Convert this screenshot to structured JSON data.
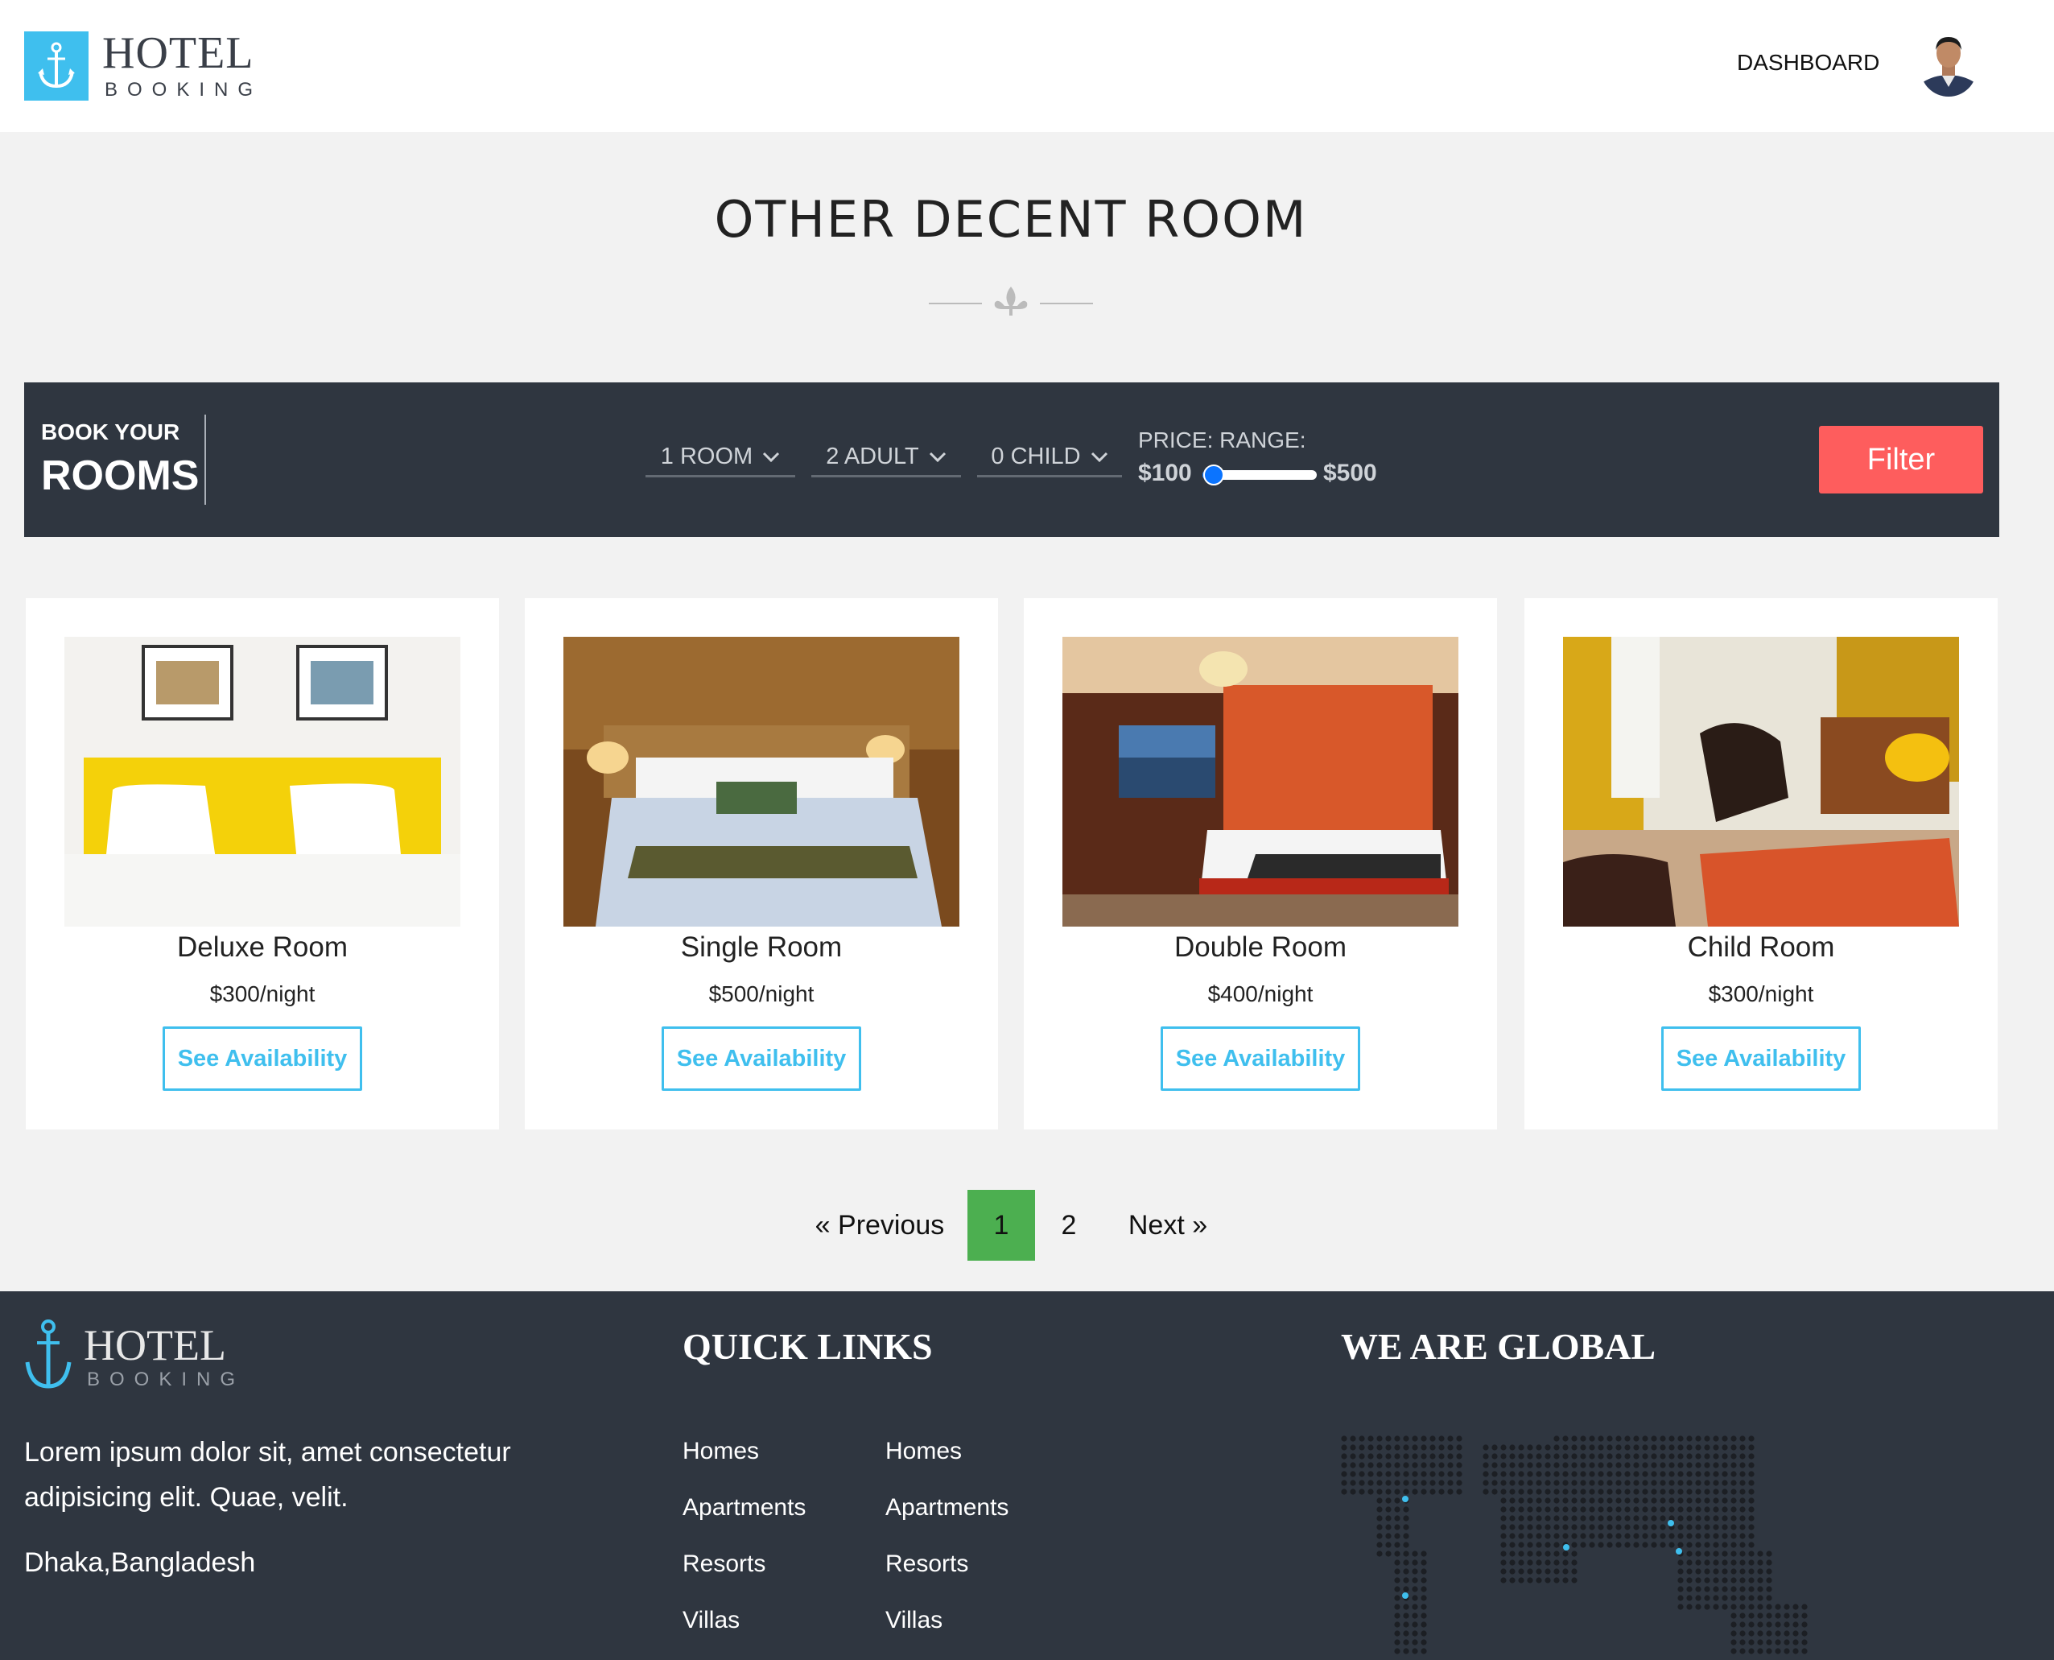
{
  "header": {
    "logo_title": "HOTEL",
    "logo_sub": "BOOKING",
    "nav_dashboard": "DASHBOARD"
  },
  "section": {
    "title": "OTHER DECENT ROOM"
  },
  "booking": {
    "label_top": "BOOK YOUR",
    "label_main": "ROOMS",
    "rooms": "1 ROOM",
    "adults": "2 ADULT",
    "children": "0 CHILD",
    "price_label": "PRICE: RANGE:",
    "price_min": "$100",
    "price_max": "$500",
    "slider_value_fraction": 0.1,
    "filter_label": "Filter"
  },
  "rooms": [
    {
      "name": "Deluxe Room",
      "price": "$300/night",
      "button": "See Availability"
    },
    {
      "name": "Single Room",
      "price": "$500/night",
      "button": "See Availability"
    },
    {
      "name": "Double Room",
      "price": "$400/night",
      "button": "See Availability"
    },
    {
      "name": "Child Room",
      "price": "$300/night",
      "button": "See Availability"
    }
  ],
  "pagination": {
    "previous": "« Previous",
    "pages": [
      "1",
      "2"
    ],
    "active_page": "1",
    "next": "Next »"
  },
  "footer": {
    "logo_title": "HOTEL",
    "logo_sub": "BOOKING",
    "description": "Lorem ipsum dolor sit, amet consectetur adipisicing elit. Quae, velit.",
    "address": "Dhaka,Bangladesh",
    "quick_links_heading": "QUICK LINKS",
    "links_col1": [
      "Homes",
      "Apartments",
      "Resorts",
      "Villas"
    ],
    "links_col2": [
      "Homes",
      "Apartments",
      "Resorts",
      "Villas"
    ],
    "global_heading": "WE ARE GLOBAL"
  },
  "colors": {
    "accent": "#3fbfee",
    "filter": "#fe5d5d",
    "dark": "#2f3640",
    "active_page": "#4caf50"
  }
}
